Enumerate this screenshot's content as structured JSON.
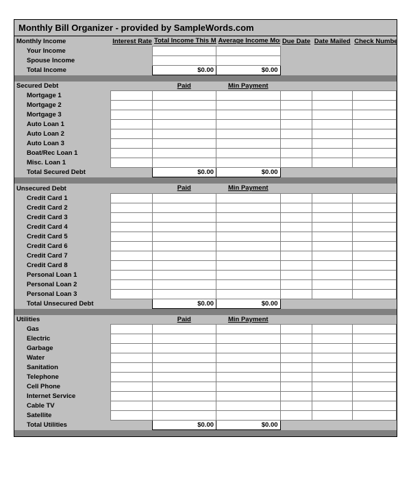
{
  "title": "Monthly Bill Organizer - provided by SampleWords.com",
  "headers": {
    "interest_rate": "Interest Rate",
    "total_income_this_month": "Total Income This Month",
    "average_income_monthly": "Average Income Monthly",
    "due_date": "Due Date",
    "date_mailed": "Date Mailed",
    "check_number": "Check Number",
    "paid": "Paid",
    "min_payment": "Min Payment"
  },
  "income": {
    "heading": "Monthly Income",
    "rows": [
      "Your Income",
      "Spouse Income"
    ],
    "total_label": "Total Income",
    "total_a": "$0.00",
    "total_b": "$0.00"
  },
  "sections": [
    {
      "heading": "Secured Debt",
      "rows": [
        "Mortgage 1",
        "Mortgage 2",
        "Mortgage 3",
        "Auto Loan 1",
        "Auto Loan 2",
        "Auto Loan 3",
        "Boat/Rec Loan 1",
        "Misc. Loan 1"
      ],
      "total_label": "Total Secured Debt",
      "total_a": "$0.00",
      "total_b": "$0.00"
    },
    {
      "heading": "Unsecured Debt",
      "rows": [
        "Credit Card 1",
        "Credit Card 2",
        "Credit Card 3",
        "Credit Card 4",
        "Credit Card 5",
        "Credit Card 6",
        "Credit Card 7",
        "Credit Card 8",
        "Personal Loan 1",
        "Personal Loan 2",
        "Personal Loan 3"
      ],
      "total_label": "Total Unsecured Debt",
      "total_a": "$0.00",
      "total_b": "$0.00"
    },
    {
      "heading": "Utilities",
      "rows": [
        "Gas",
        "Electric",
        "Garbage",
        "Water",
        "Sanitation",
        "Telephone",
        "Cell Phone",
        "Internet Service",
        "Cable TV",
        "Satellite"
      ],
      "total_label": "Total Utilities",
      "total_a": "$0.00",
      "total_b": "$0.00"
    }
  ]
}
